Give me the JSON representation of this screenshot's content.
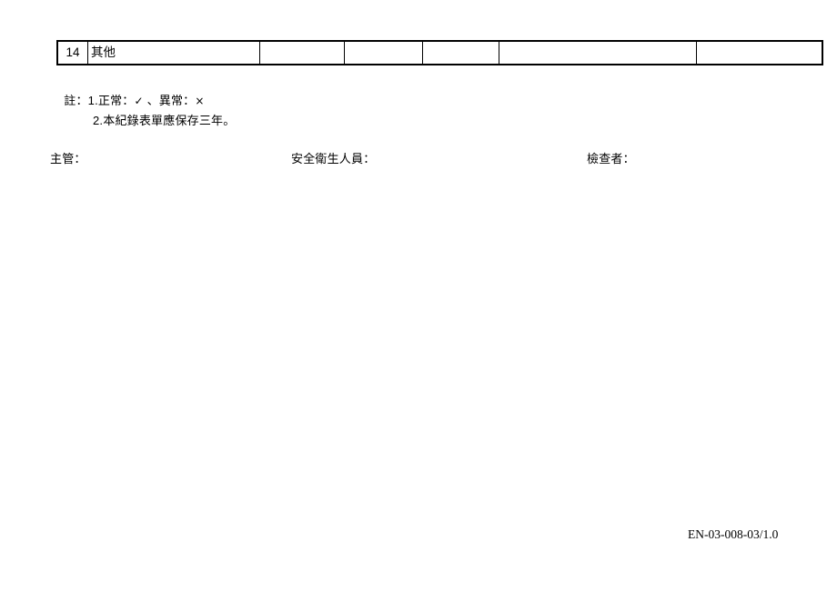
{
  "document": {
    "type": "inspection-record-form-tail",
    "language": "zh-Hant"
  },
  "table": {
    "columns": [
      {
        "key": "no",
        "header": ""
      },
      {
        "key": "item",
        "header": ""
      },
      {
        "key": "c1",
        "header": ""
      },
      {
        "key": "c2",
        "header": ""
      },
      {
        "key": "c3",
        "header": ""
      },
      {
        "key": "c4",
        "header": ""
      },
      {
        "key": "c5",
        "header": ""
      }
    ],
    "rows": [
      {
        "no": "14",
        "item": "其他",
        "c1": "",
        "c2": "",
        "c3": "",
        "c4": "",
        "c5": ""
      }
    ]
  },
  "notes": {
    "note_1": "註：1.正常：✓ 、異常：×",
    "note_1_prefix": "註：1.正常：",
    "note_1_check": "✓",
    "note_1_middle": " 、異常：",
    "note_1_cross": "×",
    "note_2": "2.本紀錄表單應保存三年。"
  },
  "signatures": {
    "supervisor": "主管：",
    "safety_officer": "安全衛生人員：",
    "inspector": "檢查者："
  },
  "footer": {
    "doc_code": "EN-03-008-03/1.0"
  },
  "colors": {
    "ink": "#000000",
    "paper": "#ffffff",
    "border": "#000000"
  }
}
